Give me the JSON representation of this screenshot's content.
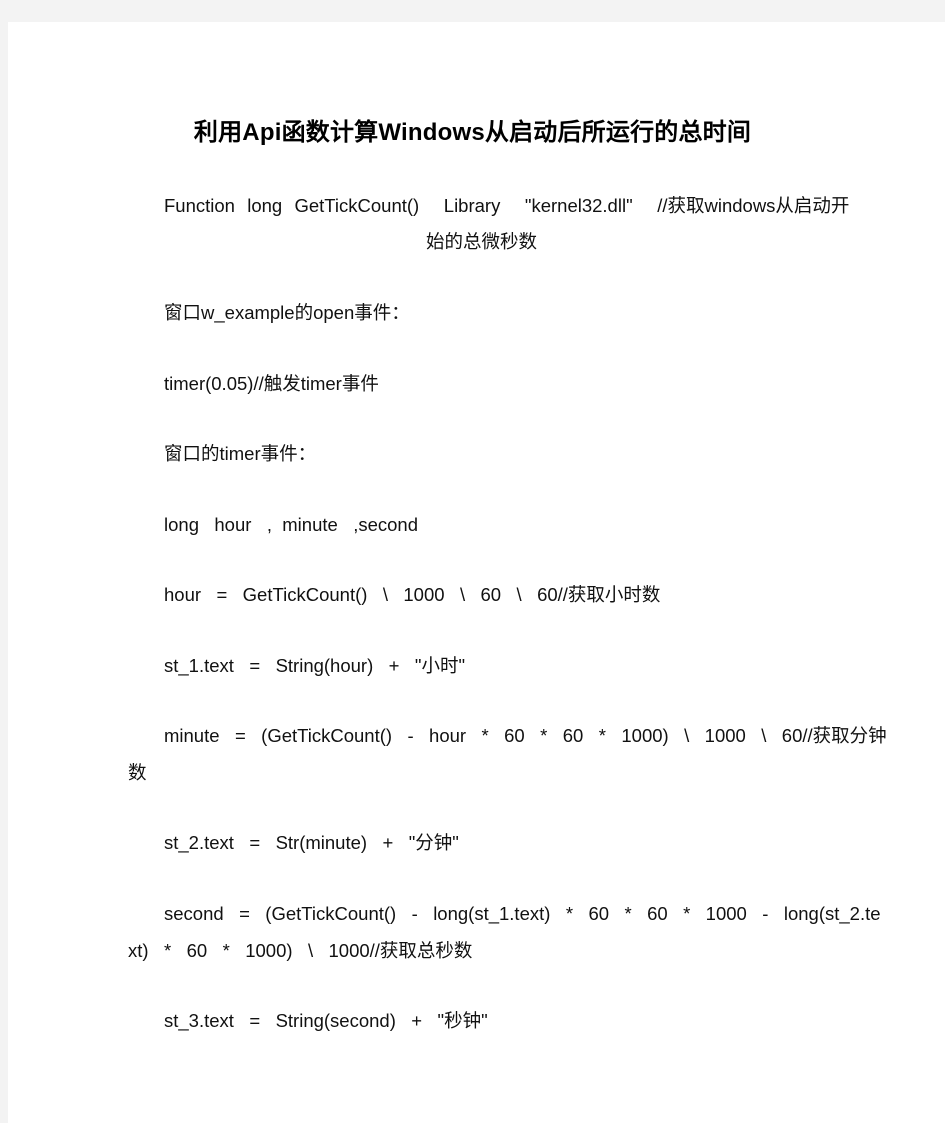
{
  "document": {
    "title": "利用Api函数计算Windows从启动后所运行的总时间",
    "lines": [
      {
        "text": "Function  long  GetTickCount()    Library    \"kernel32.dll\"    //获取windows从启动开"
      },
      {
        "text": "始的总微秒数"
      },
      {
        "text": "窗口w_example的open事件："
      },
      {
        "text": "timer(0.05)//触发timer事件"
      },
      {
        "text": "窗口的timer事件："
      },
      {
        "text": "long   hour   ,  minute   ,second"
      },
      {
        "text": "hour   =   GetTickCount()   \\   1000   \\   60   \\   60//获取小时数"
      },
      {
        "text": "st_1.text   =   String(hour)   +   \"小时\""
      },
      {
        "text": "minute   =   (GetTickCount()   -   hour   *   60   *   60   *   1000)   \\   1000   \\   60//获取分钟"
      },
      {
        "text": "数"
      },
      {
        "text": "st_2.text   =   Str(minute)   +   \"分钟\""
      },
      {
        "text": "second   =   (GetTickCount()   -   long(st_1.text)   *   60   *   60   *   1000   -   long(st_2.te"
      },
      {
        "text": "xt)   *   60   *   1000)   \\   1000//获取总秒数"
      },
      {
        "text": "st_3.text   =   String(second)   +   \"秒钟\""
      }
    ]
  }
}
